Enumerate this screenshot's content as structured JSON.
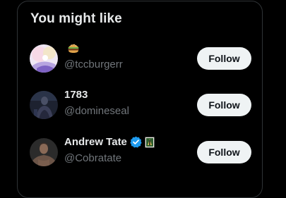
{
  "card": {
    "title": "You might like"
  },
  "suggestions": [
    {
      "name": "",
      "name_emoji": "burger-emoji",
      "handle": "@tccburgerr",
      "follow_label": "Follow",
      "avatar_icon": "pastel-illustration-avatar"
    },
    {
      "name": "1783",
      "handle": "@domineseal",
      "follow_label": "Follow",
      "avatar_icon": "dark-figure-avatar"
    },
    {
      "name": "Andrew Tate",
      "verified": true,
      "name_badge": "flag-emoji",
      "handle": "@Cobratate",
      "follow_label": "Follow",
      "avatar_icon": "person-photo-avatar"
    }
  ],
  "colors": {
    "background": "#000000",
    "border": "#2f3336",
    "text_primary": "#e7e9ea",
    "text_secondary": "#71767b",
    "button_bg": "#eff3f4",
    "button_text": "#0f1419",
    "verified": "#1d9bf0"
  }
}
